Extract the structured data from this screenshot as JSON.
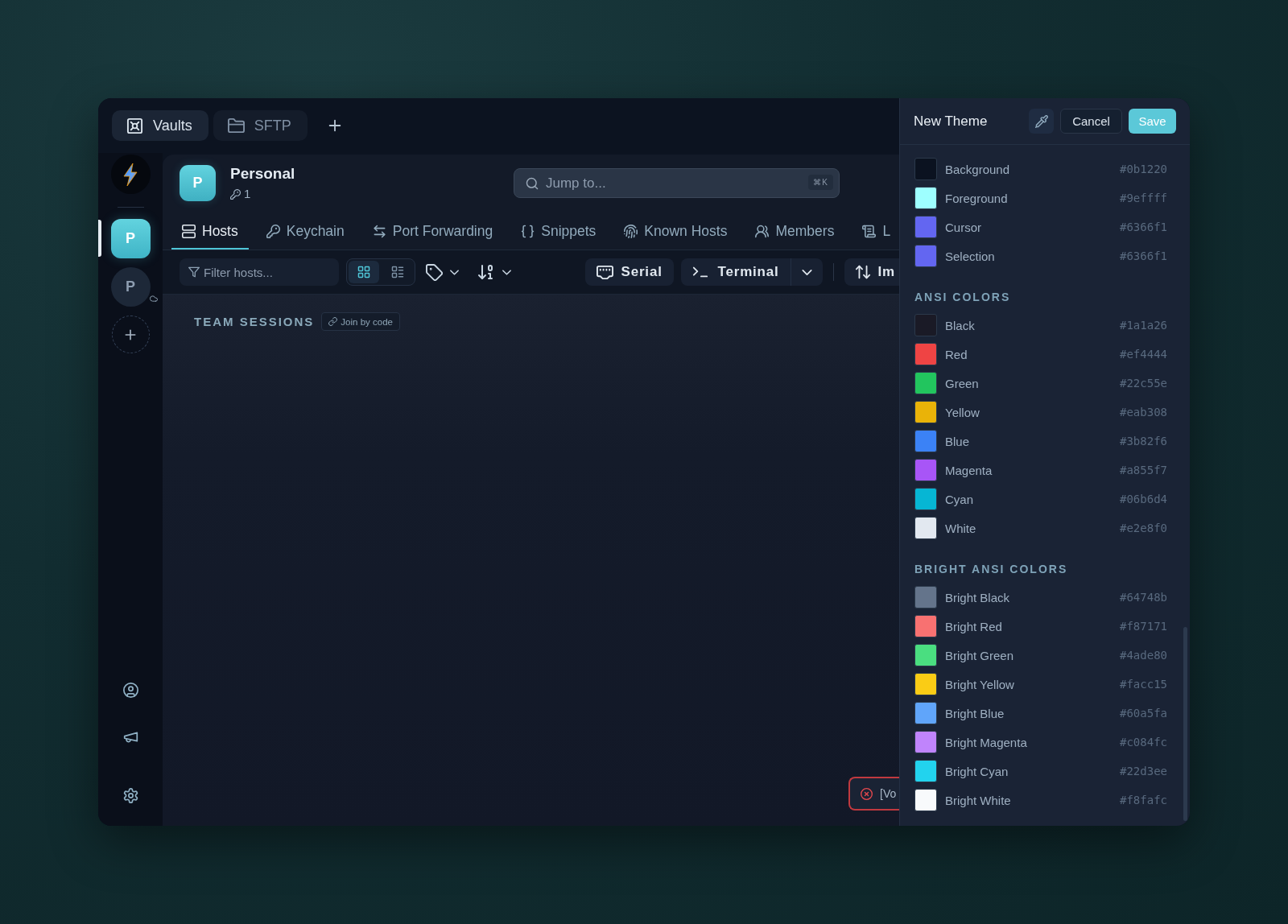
{
  "app_tabs": [
    {
      "label": "Vaults",
      "selected": true
    },
    {
      "label": "SFTP",
      "selected": false
    }
  ],
  "sidebar": {
    "vaults": [
      {
        "letter": "P",
        "selected": true,
        "cloud": false
      },
      {
        "letter": "P",
        "selected": false,
        "cloud": true
      }
    ]
  },
  "workspace": {
    "avatar": "P",
    "name": "Personal",
    "key_count": "1"
  },
  "search": {
    "placeholder": "Jump to...",
    "shortcut": "⌘K"
  },
  "nav_tabs": [
    {
      "label": "Hosts",
      "selected": true
    },
    {
      "label": "Keychain",
      "selected": false
    },
    {
      "label": "Port Forwarding",
      "selected": false
    },
    {
      "label": "Snippets",
      "selected": false
    },
    {
      "label": "Known Hosts",
      "selected": false
    },
    {
      "label": "Members",
      "selected": false
    },
    {
      "label": "L",
      "selected": false
    }
  ],
  "toolbar": {
    "filter_placeholder": "Filter hosts...",
    "view_modes": [
      {
        "selected": true
      },
      {
        "selected": false
      }
    ],
    "serial": "Serial",
    "terminal": "Terminal",
    "import": "Im"
  },
  "team_sessions": {
    "heading": "TEAM SESSIONS",
    "join": "Join by code"
  },
  "toast": {
    "kind": "error",
    "text": "[Vo"
  },
  "theme_editor": {
    "title": "New Theme",
    "cancel": "Cancel",
    "save": "Save",
    "sections": [
      {
        "rows": [
          {
            "name": "Background",
            "value": "#0b1220",
            "color": "#0b1220"
          },
          {
            "name": "Foreground",
            "value": "#9effff",
            "color": "#9effff"
          },
          {
            "name": "Cursor",
            "value": "#6366f1",
            "color": "#6366f1"
          },
          {
            "name": "Selection",
            "value": "#6366f1",
            "color": "#6366f1"
          }
        ]
      },
      {
        "heading": "ANSI COLORS",
        "rows": [
          {
            "name": "Black",
            "value": "#1a1a26",
            "color": "#1a1a26"
          },
          {
            "name": "Red",
            "value": "#ef4444",
            "color": "#ef4444"
          },
          {
            "name": "Green",
            "value": "#22c55e",
            "color": "#22c55e"
          },
          {
            "name": "Yellow",
            "value": "#eab308",
            "color": "#eab308"
          },
          {
            "name": "Blue",
            "value": "#3b82f6",
            "color": "#3b82f6"
          },
          {
            "name": "Magenta",
            "value": "#a855f7",
            "color": "#a855f7"
          },
          {
            "name": "Cyan",
            "value": "#06b6d4",
            "color": "#06b6d4"
          },
          {
            "name": "White",
            "value": "#e2e8f0",
            "color": "#e2e8f0"
          }
        ]
      },
      {
        "heading": "BRIGHT ANSI COLORS",
        "rows": [
          {
            "name": "Bright Black",
            "value": "#64748b",
            "color": "#64748b"
          },
          {
            "name": "Bright Red",
            "value": "#f87171",
            "color": "#f87171"
          },
          {
            "name": "Bright Green",
            "value": "#4ade80",
            "color": "#4ade80"
          },
          {
            "name": "Bright Yellow",
            "value": "#facc15",
            "color": "#facc15"
          },
          {
            "name": "Bright Blue",
            "value": "#60a5fa",
            "color": "#60a5fa"
          },
          {
            "name": "Bright Magenta",
            "value": "#c084fc",
            "color": "#c084fc"
          },
          {
            "name": "Bright Cyan",
            "value": "#22d3ee",
            "color": "#22d3ee"
          },
          {
            "name": "Bright White",
            "value": "#f8fafc",
            "color": "#f8fafc"
          }
        ]
      }
    ]
  }
}
